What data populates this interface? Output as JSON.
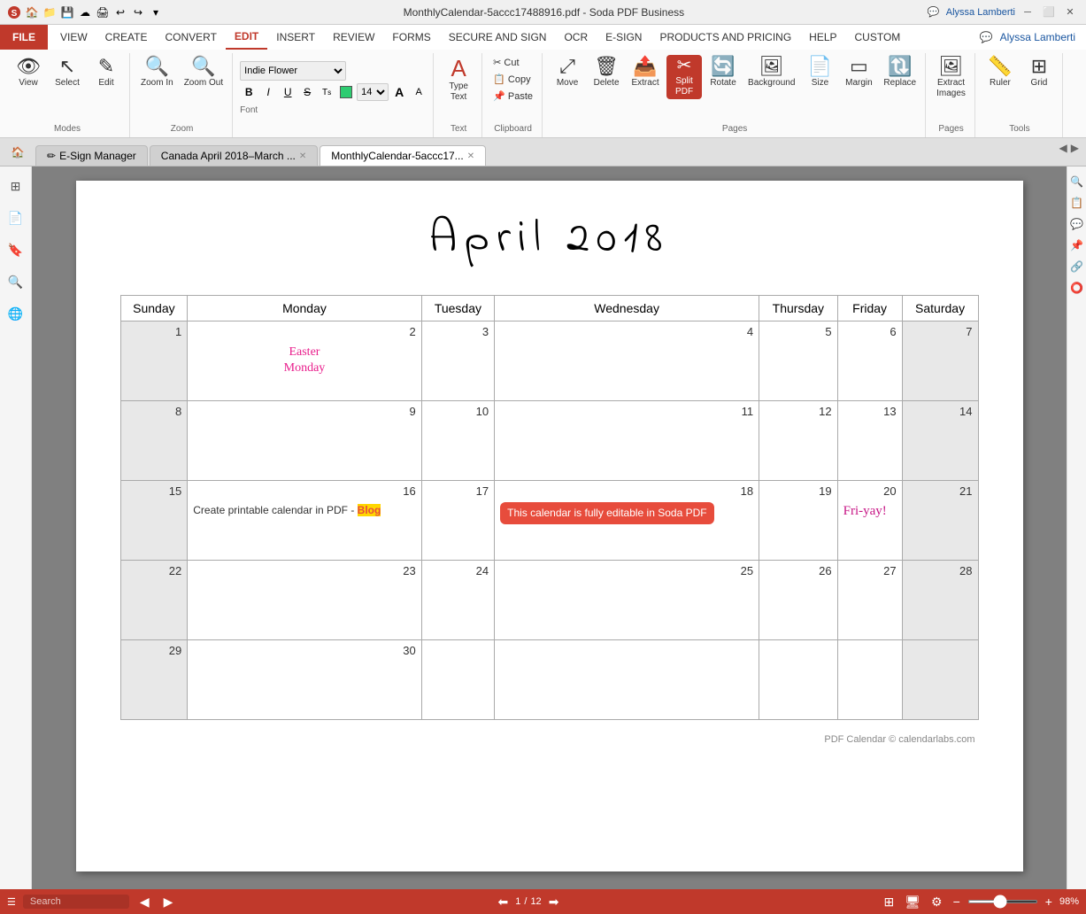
{
  "titleBar": {
    "title": "MonthlyCalendar-5accc17488916.pdf  -  Soda PDF Business",
    "user": "Alyssa Lamberti"
  },
  "menuBar": {
    "items": [
      "VIEW",
      "CREATE",
      "CONVERT",
      "EDIT",
      "INSERT",
      "REVIEW",
      "FORMS",
      "SECURE AND SIGN",
      "OCR",
      "E-SIGN",
      "PRODUCTS AND PRICING",
      "HELP",
      "CUSTOM"
    ],
    "activeItem": "EDIT",
    "fileLabel": "FILE"
  },
  "ribbon": {
    "modes": {
      "label": "Modes",
      "buttons": [
        "View",
        "Select",
        "Edit"
      ]
    },
    "zoom": {
      "label": "Zoom",
      "buttons": [
        "Zoom In",
        "Zoom Out"
      ]
    },
    "font": {
      "label": "Font",
      "family": "Indie Flower",
      "size": "14",
      "bold": "B",
      "italic": "I",
      "underline": "U",
      "strikethrough": "S",
      "sup": "T",
      "sub": "T",
      "grow": "A",
      "shrink": "A"
    },
    "text": {
      "label": "Text",
      "buttons": [
        "Type Text"
      ]
    },
    "clipboard": {
      "label": "Clipboard",
      "buttons": [
        "Cut",
        "Copy",
        "Paste"
      ]
    },
    "pages": {
      "label": "Pages",
      "buttons": [
        "Move",
        "Delete",
        "Extract",
        "Split PDF",
        "Rotate",
        "Background",
        "Size",
        "Margin",
        "Replace"
      ]
    },
    "images": {
      "label": "Pages",
      "buttons": [
        "Extract Images"
      ]
    },
    "tools": {
      "label": "Tools",
      "buttons": [
        "Ruler",
        "Grid"
      ]
    }
  },
  "tabs": [
    {
      "label": "E-Sign Manager",
      "active": false,
      "closable": false
    },
    {
      "label": "Canada April 2018–March ...",
      "active": false,
      "closable": true
    },
    {
      "label": "MonthlyCalendar-5accc17...",
      "active": true,
      "closable": true
    }
  ],
  "calendar": {
    "title": "April  2018",
    "headers": [
      "Sunday",
      "Monday",
      "Tuesday",
      "Wednesday",
      "Thursday",
      "Friday",
      "Saturday"
    ],
    "weeks": [
      [
        {
          "day": 1,
          "weekend": true,
          "note": ""
        },
        {
          "day": 2,
          "weekend": false,
          "note": "Easter Monday"
        },
        {
          "day": 3,
          "weekend": false,
          "note": ""
        },
        {
          "day": 4,
          "weekend": false,
          "note": ""
        },
        {
          "day": 5,
          "weekend": false,
          "note": ""
        },
        {
          "day": 6,
          "weekend": false,
          "note": ""
        },
        {
          "day": 7,
          "weekend": true,
          "note": ""
        }
      ],
      [
        {
          "day": 8,
          "weekend": true,
          "note": ""
        },
        {
          "day": 9,
          "weekend": false,
          "note": ""
        },
        {
          "day": 10,
          "weekend": false,
          "note": ""
        },
        {
          "day": 11,
          "weekend": false,
          "note": ""
        },
        {
          "day": 12,
          "weekend": false,
          "note": ""
        },
        {
          "day": 13,
          "weekend": false,
          "note": ""
        },
        {
          "day": 14,
          "weekend": true,
          "note": ""
        }
      ],
      [
        {
          "day": 15,
          "weekend": true,
          "note": ""
        },
        {
          "day": 16,
          "weekend": false,
          "note": "blog"
        },
        {
          "day": 17,
          "weekend": false,
          "note": ""
        },
        {
          "day": 18,
          "weekend": false,
          "note": "red-note"
        },
        {
          "day": 19,
          "weekend": false,
          "note": ""
        },
        {
          "day": 20,
          "weekend": false,
          "note": "fri-yay"
        },
        {
          "day": 21,
          "weekend": true,
          "note": ""
        }
      ],
      [
        {
          "day": 22,
          "weekend": true,
          "note": ""
        },
        {
          "day": 23,
          "weekend": false,
          "note": ""
        },
        {
          "day": 24,
          "weekend": false,
          "note": ""
        },
        {
          "day": 25,
          "weekend": false,
          "note": ""
        },
        {
          "day": 26,
          "weekend": false,
          "note": ""
        },
        {
          "day": 27,
          "weekend": false,
          "note": ""
        },
        {
          "day": 28,
          "weekend": true,
          "note": ""
        }
      ],
      [
        {
          "day": 29,
          "weekend": true,
          "note": ""
        },
        {
          "day": 30,
          "weekend": false,
          "note": ""
        },
        {
          "day": null,
          "weekend": false,
          "note": ""
        },
        {
          "day": null,
          "weekend": false,
          "note": ""
        },
        {
          "day": null,
          "weekend": false,
          "note": ""
        },
        {
          "day": null,
          "weekend": false,
          "note": ""
        },
        {
          "day": null,
          "weekend": true,
          "note": ""
        }
      ]
    ],
    "notes": {
      "easterMonday": "Easter\nMonday",
      "blogText": "Create printable calendar in PDF - Blog",
      "redNote": "This calendar is fully editable in Soda PDF",
      "friyay": "Fri-yay!"
    },
    "footer": "PDF Calendar © calendarlabs.com"
  },
  "statusBar": {
    "searchPlaceholder": "Search",
    "page": "1",
    "totalPages": "12",
    "zoom": "98%"
  }
}
